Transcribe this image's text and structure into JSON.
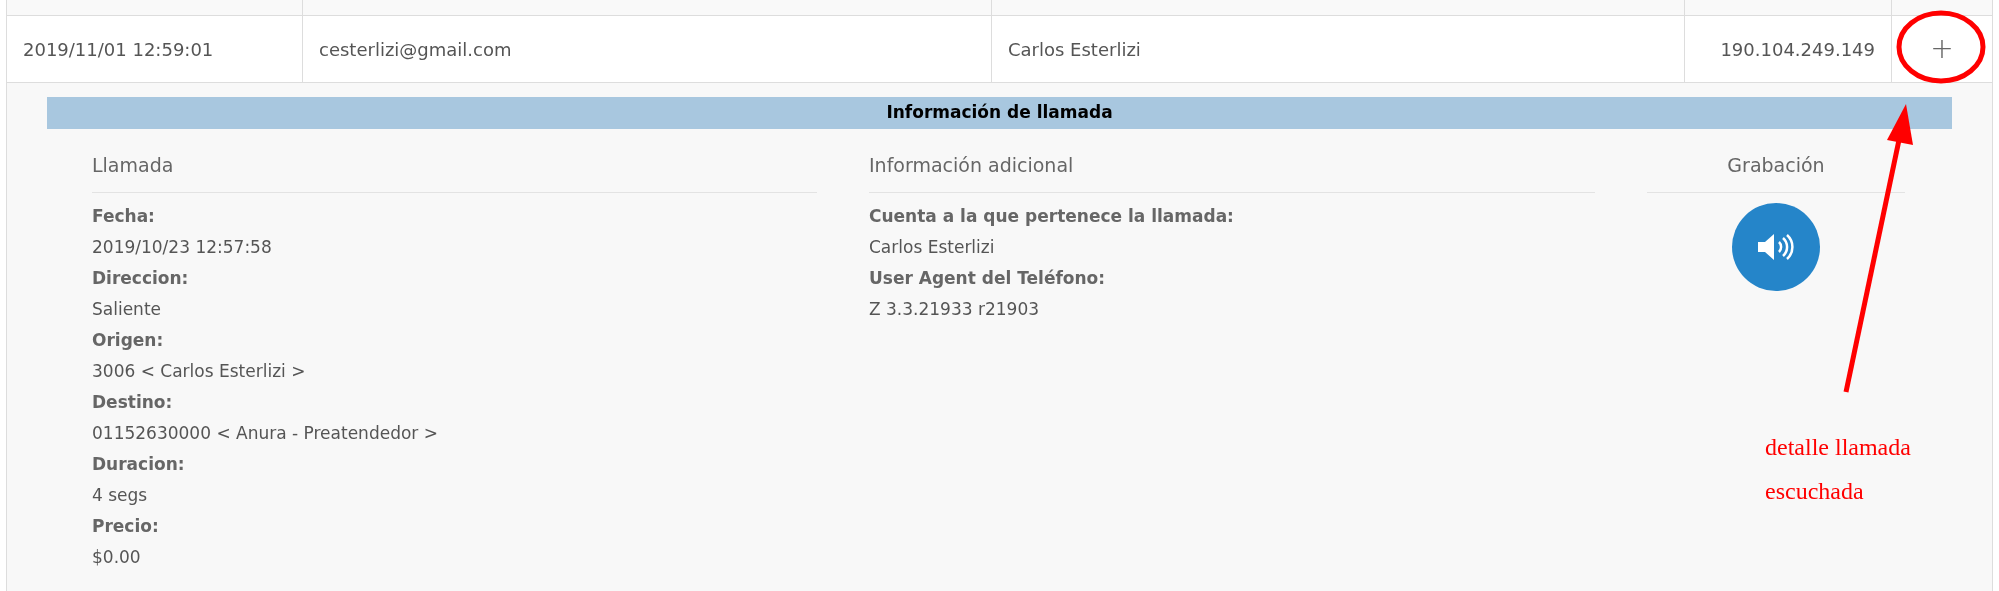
{
  "row": {
    "cells": [
      "2019/11/01 12:59:01",
      "cesterlizi@gmail.com",
      "Carlos Esterlizi",
      "190.104.249.149"
    ],
    "expand_button": "+",
    "expanded": true
  },
  "details": {
    "title": "Información de llamada",
    "sections": [
      {
        "heading": "Llamada",
        "fields": [
          {
            "label": "Fecha:",
            "value": "2019/10/23 12:57:58"
          },
          {
            "label": "Direccion:",
            "value": "Saliente"
          },
          {
            "label": "Origen:",
            "value": "3006 < Carlos Esterlizi >"
          },
          {
            "label": "Destino:",
            "value": "01152630000 < Anura - Preatendedor >"
          },
          {
            "label": "Duracion:",
            "value": "4 segs"
          },
          {
            "label": "Precio:",
            "value": "$0.00"
          }
        ]
      },
      {
        "heading": "Información adicional",
        "fields": [
          {
            "label": "Cuenta a la que pertenece la llamada:",
            "value": "Carlos Esterlizi"
          },
          {
            "label": "User Agent del Teléfono:",
            "value": "Z 3.3.21933 r21903"
          }
        ]
      }
    ],
    "recording": {
      "heading": "Grabación"
    }
  },
  "annotation": {
    "lines": [
      "detalle llamada",
      "escuchada"
    ]
  }
}
